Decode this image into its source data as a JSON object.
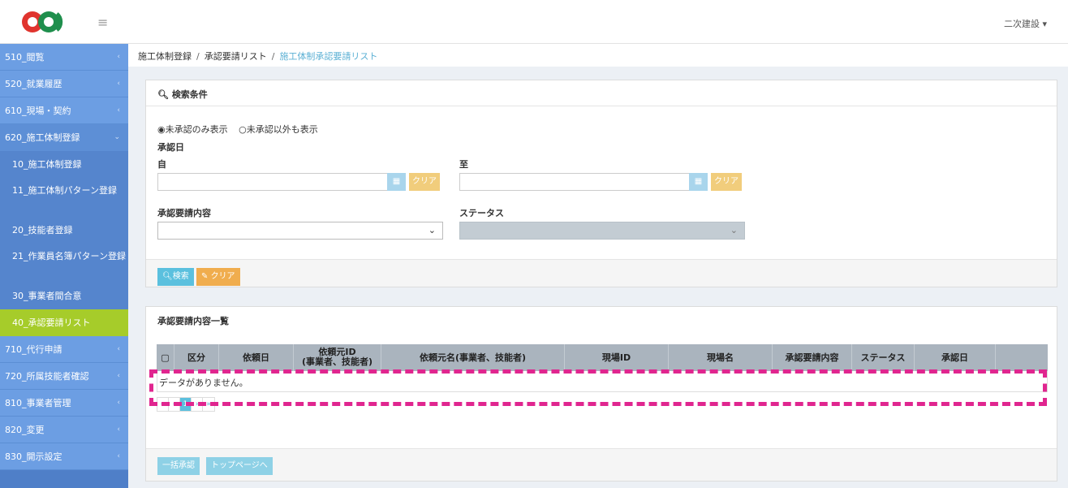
{
  "header": {
    "user_menu": "二次建設 ▾"
  },
  "sidebar": {
    "items": [
      {
        "label": "510_閲覧"
      },
      {
        "label": "520_就業履歴"
      },
      {
        "label": "610_現場・契約"
      },
      {
        "label": "620_施工体制登録"
      },
      {
        "label": "710_代行申請"
      },
      {
        "label": "720_所属技能者確認"
      },
      {
        "label": "810_事業者管理"
      },
      {
        "label": "820_変更"
      },
      {
        "label": "830_開示設定"
      }
    ],
    "subitems": [
      {
        "label": "10_施工体制登録"
      },
      {
        "label": "11_施工体制パターン登録"
      },
      {
        "label": "20_技能者登録"
      },
      {
        "label": "21_作業員名簿パターン登録"
      },
      {
        "label": "30_事業者間合意"
      },
      {
        "label": "40_承認要請リスト"
      }
    ]
  },
  "breadcrumb": {
    "item1": "施工体制登録",
    "item2": "承認要請リスト",
    "current": "施工体制承認要請リスト",
    "sep": "/"
  },
  "search": {
    "title": "検索条件",
    "radio_unapproved": "◉未承認のみ表示",
    "radio_other": "○未承認以外も表示",
    "approval_date": "承認日",
    "from_label": "自",
    "to_label": "至",
    "clear": "クリア",
    "request_content": "承認要請内容",
    "status": "ステータス",
    "search_button": "検索",
    "clear_button": "クリア"
  },
  "list": {
    "title": "承認要請内容一覧",
    "columns": {
      "kubun": "区分",
      "request_date": "依頼日",
      "requester_id_1": "依頼元ID",
      "requester_id_2": "(事業者、技能者)",
      "requester_name": "依頼元名(事業者、技能者)",
      "site_id": "現場ID",
      "site_name": "現場名",
      "content": "承認要請内容",
      "status": "ステータス",
      "approval_date": "承認日"
    },
    "empty": "データがありません。",
    "pager": [
      "«",
      "‹",
      "1",
      "›",
      "»"
    ],
    "bulk_approve": "一括承認",
    "to_top": "トップページへ"
  },
  "colors": {
    "sidebar": "#4f7fc8",
    "active": "#a6cc2a",
    "highlight": "#e0268f"
  }
}
